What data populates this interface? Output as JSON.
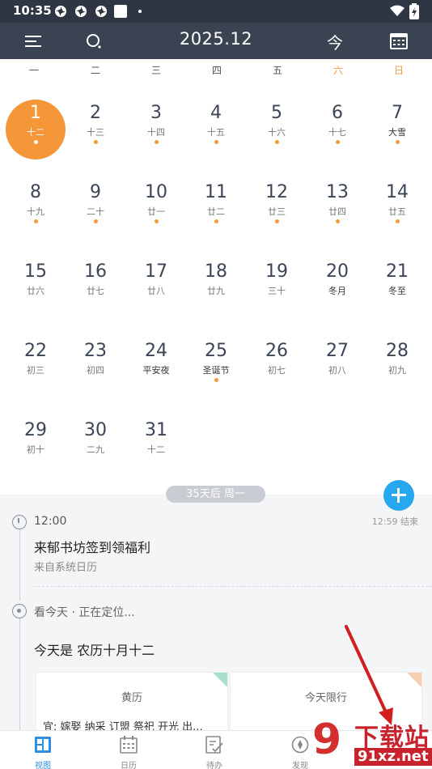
{
  "status_bar": {
    "time": "10:35"
  },
  "app_bar": {
    "title": "2025.12",
    "today_label": "今"
  },
  "weekdays": [
    "一",
    "二",
    "三",
    "四",
    "五",
    "六",
    "日"
  ],
  "colors": {
    "accent_orange": "#f59638",
    "primary_blue": "#28a7f1",
    "header_dark": "#3a4352",
    "weekend": "#f39a3a"
  },
  "days": [
    {
      "n": "1",
      "l": "十二",
      "today": true,
      "mark": true
    },
    {
      "n": "2",
      "l": "十三",
      "mark": true
    },
    {
      "n": "3",
      "l": "十四",
      "mark": true
    },
    {
      "n": "4",
      "l": "十五",
      "mark": true
    },
    {
      "n": "5",
      "l": "十六",
      "mark": true
    },
    {
      "n": "6",
      "l": "十七",
      "mark": true
    },
    {
      "n": "7",
      "l": "大雪",
      "mark": true,
      "hi": true
    },
    {
      "n": "8",
      "l": "十九",
      "mark": true
    },
    {
      "n": "9",
      "l": "二十",
      "mark": true
    },
    {
      "n": "10",
      "l": "廿一",
      "mark": true
    },
    {
      "n": "11",
      "l": "廿二",
      "mark": true
    },
    {
      "n": "12",
      "l": "廿三",
      "mark": true
    },
    {
      "n": "13",
      "l": "廿四",
      "mark": true
    },
    {
      "n": "14",
      "l": "廿五",
      "mark": true
    },
    {
      "n": "15",
      "l": "廿六"
    },
    {
      "n": "16",
      "l": "廿七"
    },
    {
      "n": "17",
      "l": "廿八"
    },
    {
      "n": "18",
      "l": "廿九"
    },
    {
      "n": "19",
      "l": "三十"
    },
    {
      "n": "20",
      "l": "冬月",
      "hi": true
    },
    {
      "n": "21",
      "l": "冬至",
      "hi": true
    },
    {
      "n": "22",
      "l": "初三"
    },
    {
      "n": "23",
      "l": "初四"
    },
    {
      "n": "24",
      "l": "平安夜",
      "hi": true
    },
    {
      "n": "25",
      "l": "圣诞节",
      "mark": true,
      "hi": true
    },
    {
      "n": "26",
      "l": "初七"
    },
    {
      "n": "27",
      "l": "初八"
    },
    {
      "n": "28",
      "l": "初九"
    },
    {
      "n": "29",
      "l": "初十"
    },
    {
      "n": "30",
      "l": "二九"
    },
    {
      "n": "31",
      "l": "十二"
    }
  ],
  "agenda": {
    "pill": "35天后 周一",
    "event": {
      "time": "12:00",
      "end": "12:59 结束",
      "title": "来郁书坊签到领福利",
      "source": "来自系统日历"
    },
    "location": "看今天 · 正在定位...",
    "today_text": "今天是 农历十月十二",
    "cards": [
      {
        "title": "黄历",
        "detail": "宜: 嫁娶 纳采 订盟 祭祀 开光 出..."
      },
      {
        "title": "今天限行",
        "detail": ""
      }
    ]
  },
  "bottom_nav": [
    {
      "label": "视图",
      "icon": "grid-view-icon",
      "active": true
    },
    {
      "label": "日历",
      "icon": "calendar-icon"
    },
    {
      "label": "待办",
      "icon": "todo-icon"
    },
    {
      "label": "发现",
      "icon": "discover-icon"
    }
  ],
  "watermark": {
    "text": "下载站",
    "url": "91xz.net",
    "logo": "9"
  }
}
